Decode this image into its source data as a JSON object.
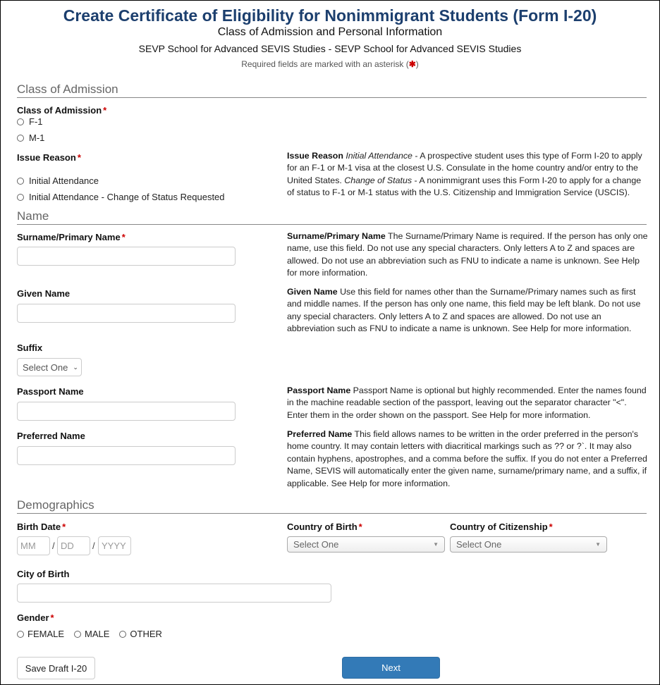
{
  "header": {
    "title": "Create Certificate of Eligibility for Nonimmigrant Students (Form I-20)",
    "subtitle": "Class of Admission and Personal Information",
    "school": "SEVP School for Advanced SEVIS Studies - SEVP School for Advanced SEVIS Studies",
    "required_note_prefix": "Required fields are marked with an asterisk (",
    "required_note_star": "✱",
    "required_note_suffix": ")"
  },
  "required_star": "*",
  "sections": {
    "class_of_admission": "Class of Admission",
    "name": "Name",
    "demographics": "Demographics"
  },
  "class_of_admission": {
    "label": "Class of Admission",
    "options": [
      "F-1",
      "M-1"
    ]
  },
  "issue_reason": {
    "label": "Issue Reason",
    "options": [
      "Initial Attendance",
      "Initial Attendance - Change of Status Requested"
    ],
    "help": {
      "title": "Issue Reason",
      "term1": "Initial Attendance",
      "text1": " - A prospective student uses this type of Form I-20 to apply for an F-1 or M-1 visa at the closest U.S. Consulate in the home country and/or entry to the United States. ",
      "term2": "Change of Status",
      "text2": " - A nonimmigrant uses this Form I-20 to apply for a change of status to F-1 or M-1 status with the U.S. Citizenship and Immigration Service (USCIS)."
    }
  },
  "name_fields": {
    "surname": {
      "label": "Surname/Primary Name",
      "value": "",
      "help_title": "Surname/Primary Name",
      "help_text": " The Surname/Primary Name is required. If the person has only one name, use this field. Do not use any special characters. Only letters A to Z and spaces are allowed. Do not use an abbreviation such as FNU to indicate a name is unknown. See Help for more information."
    },
    "given": {
      "label": "Given Name",
      "value": "",
      "help_title": "Given Name",
      "help_text": " Use this field for names other than the Surname/Primary names such as first and middle names. If the person has only one name, this field may be left blank. Do not use any special characters. Only letters A to Z and spaces are allowed. Do not use an abbreviation such as FNU to indicate a name is unknown. See Help for more information."
    },
    "suffix": {
      "label": "Suffix",
      "selected": "Select One"
    },
    "passport": {
      "label": "Passport Name",
      "value": "",
      "help_title": "Passport Name",
      "help_text": " Passport Name is optional but highly recommended. Enter the names found in the machine readable section of the passport, leaving out the separator character \"<\". Enter them in the order shown on the passport. See Help for more information."
    },
    "preferred": {
      "label": "Preferred Name",
      "value": "",
      "help_title": "Preferred Name",
      "help_text": " This field allows names to be written in the order preferred in the person's home country. It may contain letters with diacritical markings such as ?? or ?`. It may also contain hyphens, apostrophes, and a comma before the suffix. If you do not enter a Preferred Name, SEVIS will automatically enter the given name, surname/primary name, and a suffix, if applicable. See Help for more information."
    }
  },
  "demographics": {
    "birth_date": {
      "label": "Birth Date",
      "mm_placeholder": "MM",
      "dd_placeholder": "DD",
      "yyyy_placeholder": "YYYY",
      "separator": "/"
    },
    "country_of_birth": {
      "label": "Country of Birth",
      "selected": "Select One"
    },
    "country_of_citizenship": {
      "label": "Country of Citizenship",
      "selected": "Select One"
    },
    "city_of_birth": {
      "label": "City of Birth",
      "value": ""
    },
    "gender": {
      "label": "Gender",
      "options": [
        "FEMALE",
        "MALE",
        "OTHER"
      ]
    }
  },
  "buttons": {
    "save_draft": "Save Draft I-20",
    "next": "Next"
  },
  "colors": {
    "title": "#1c3f6e",
    "required": "#cc0000",
    "primary_button": "#337ab7"
  }
}
